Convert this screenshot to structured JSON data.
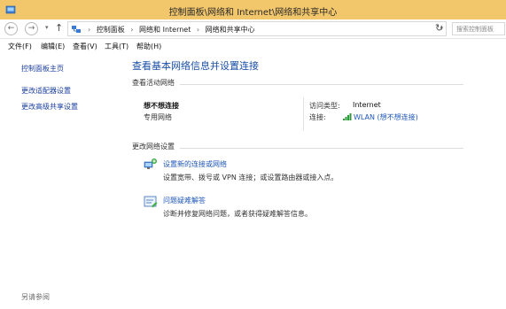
{
  "window": {
    "title": "控制面板\\网络和 Internet\\网络和共享中心"
  },
  "address": {
    "crumbs": [
      "控制面板",
      "网络和 Internet",
      "网络和共享中心"
    ],
    "search_placeholder": "搜索控制面板"
  },
  "menu": {
    "items": [
      "文件(F)",
      "编辑(E)",
      "查看(V)",
      "工具(T)",
      "帮助(H)"
    ]
  },
  "sidebar": {
    "items": [
      "控制面板主页",
      "更改适配器设置",
      "更改高级共享设置"
    ],
    "see_also": "另请参阅"
  },
  "main": {
    "title": "查看基本网络信息并设置连接",
    "active_networks": {
      "heading": "查看活动网络",
      "network_name": "想不想连接",
      "network_type": "专用网络",
      "access_type_label": "访问类型:",
      "access_type_value": "Internet",
      "connection_label": "连接:",
      "connection_value": "WLAN (想不想连接)"
    },
    "change_settings": {
      "heading": "更改网络设置",
      "tasks": [
        {
          "title": "设置新的连接或网络",
          "desc": "设置宽带、拨号或 VPN 连接；或设置路由器或接入点。"
        },
        {
          "title": "问题疑难解答",
          "desc": "诊断并修复网络问题，或者获得疑难解答信息。"
        }
      ]
    }
  },
  "colors": {
    "titlebar": "#f2c66a",
    "link": "#1f57b8",
    "left_link": "#1b3fa0",
    "page_title": "#1a4ea6"
  }
}
